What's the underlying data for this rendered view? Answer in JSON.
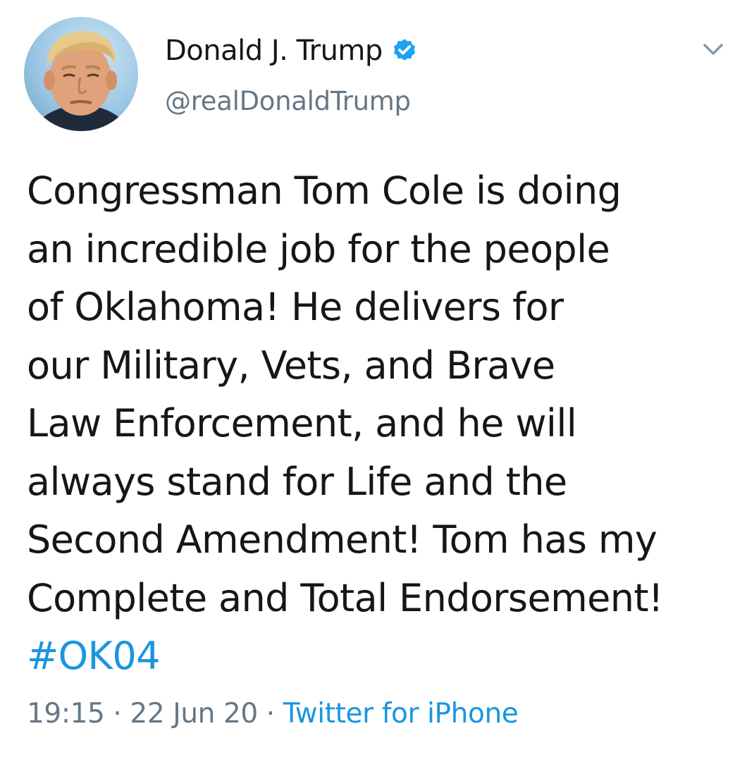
{
  "author": {
    "display_name": "Donald J. Trump",
    "handle": "@realDonaldTrump",
    "verified": true,
    "avatar_icon": "profile-photo",
    "verified_icon": "verified-badge-icon"
  },
  "menu": {
    "icon": "chevron-down-icon"
  },
  "tweet": {
    "lines": [
      "Congressman Tom Cole is doing",
      "an incredible job for the people",
      "of Oklahoma! He delivers for",
      "our Military, Vets, and Brave",
      "Law Enforcement, and he will",
      "always stand for Life and the",
      "Second Amendment! Tom has my",
      "Complete and Total Endorsement!"
    ],
    "hashtag": "#OK04"
  },
  "meta": {
    "time": "19:15",
    "separator": "·",
    "date": "22 Jun 20",
    "source": "Twitter for iPhone"
  },
  "colors": {
    "text": "#14171a",
    "secondary": "#657786",
    "link": "#1b95e0",
    "verified": "#1da1f2"
  }
}
